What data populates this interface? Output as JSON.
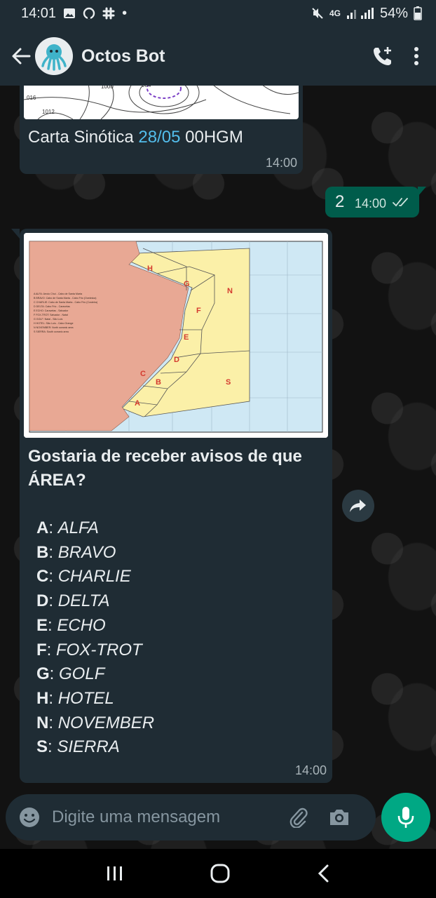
{
  "status_bar": {
    "time": "14:01",
    "dot": "•",
    "network": "4G",
    "battery": "54%",
    "icons": [
      "image-icon",
      "github-icon",
      "slack-icon",
      "mute-icon",
      "signal-icon",
      "battery-icon"
    ]
  },
  "header": {
    "title": "Octos Bot",
    "avatar_icon": "octopus-icon",
    "actions": [
      "add-call-icon",
      "more-vert-icon"
    ]
  },
  "messages": [
    {
      "direction": "incoming",
      "caption_prefix": "Carta Sinótica ",
      "caption_link": "28/05",
      "caption_suffix": " 00HGM",
      "time": "14:00",
      "map_fragment_labels": [
        "016",
        "1012",
        "1000",
        "984"
      ]
    },
    {
      "direction": "outgoing",
      "text": "2",
      "time": "14:00",
      "status_icon": "double-check-icon"
    },
    {
      "direction": "incoming",
      "map": {
        "area_letters": [
          "H",
          "G",
          "N",
          "F",
          "E",
          "D",
          "C",
          "B",
          "S",
          "A"
        ],
        "legend": [
          "A  ALFA: Arroio Chuí - Cabo de Santa Marta",
          "B  BRAVO: Cabo de Santa Marta - Cabo Frio (Oceânica)",
          "C  CHARLIE: Cabo de Santa Marta - Cabo Frio (Costeira)",
          "D  DELTA: Cabo Frio - Caravelas",
          "E  ECHO: Caravelas - Salvador",
          "F  FOX-TROT: Salvador - Natal",
          "G  GOLF: Natal - São Luís",
          "H  HOTEL: São Luís - Cabo Orange",
          "N  NOVEMBER: North oceanic area",
          "S  SIERRA: South oceanic area"
        ]
      },
      "question": "Gostaria de receber avisos de que ÁREA?",
      "options": [
        {
          "key": "A",
          "label": "ALFA"
        },
        {
          "key": "B",
          "label": "BRAVO"
        },
        {
          "key": "C",
          "label": "CHARLIE"
        },
        {
          "key": "D",
          "label": "DELTA"
        },
        {
          "key": "E",
          "label": "ECHO"
        },
        {
          "key": "F",
          "label": "FOX-TROT"
        },
        {
          "key": "G",
          "label": "GOLF"
        },
        {
          "key": "H",
          "label": "HOTEL"
        },
        {
          "key": "N",
          "label": "NOVEMBER"
        },
        {
          "key": "S",
          "label": "SIERRA"
        }
      ],
      "time": "14:00"
    }
  ],
  "input": {
    "placeholder": "Digite uma mensagem"
  },
  "colors": {
    "header_bg": "#1f2c34",
    "incoming_bubble": "#1f2c34",
    "outgoing_bubble": "#005c4b",
    "accent": "#00a884",
    "link": "#53bdeb",
    "land": "#e8a894",
    "areas": "#fbf0a8",
    "sea": "#cfe8f4",
    "area_label": "#d43a2f"
  }
}
